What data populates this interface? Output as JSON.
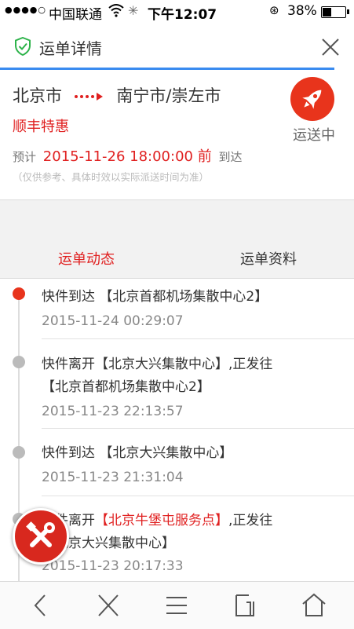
{
  "status_bar": {
    "signal": "●●●●○",
    "carrier": "中国联通",
    "time": "下午12:07",
    "battery": "38%",
    "battery_level": 0.38
  },
  "header": {
    "title": "运单详情"
  },
  "summary": {
    "origin": "北京市",
    "destination": "南宁市/崇左市",
    "service": "顺丰特惠",
    "eta_prefix": "预计",
    "eta_time": "2015-11-26 18:00:00 前",
    "eta_suffix": "到达",
    "note": "（仅供参考、具体时效以实际派送时间为准）",
    "status": "运送中"
  },
  "tabs": [
    {
      "label": "运单动态",
      "active": true
    },
    {
      "label": "运单资料",
      "active": false
    }
  ],
  "events": [
    {
      "line1_pre": "快件到达 ",
      "line1_loc": "【北京首都机场集散中心2】",
      "line1_post": "",
      "line2": "",
      "time": "2015-11-24 00:29:07"
    },
    {
      "line1_pre": "快件离开",
      "line1_loc": "【北京大兴集散中心】",
      "line1_post": ",正发往",
      "line2": "【北京首都机场集散中心2】",
      "time": "2015-11-23 22:13:57"
    },
    {
      "line1_pre": "快件到达 ",
      "line1_loc": "【北京大兴集散中心】",
      "line1_post": "",
      "line2": "",
      "time": "2015-11-23 21:31:04"
    },
    {
      "line1_pre": "快件离开",
      "line1_loc": "【北京牛堡屯服务点】",
      "line1_post": ",正发往",
      "line2": "【北京大兴集散中心】",
      "time": "2015-11-23 20:17:33"
    }
  ],
  "colors": {
    "accent_red": "#e02020",
    "progress_blue": "#3a8bf0",
    "badge_red": "#e8341c"
  },
  "icons": {
    "header_left": "shield-icon",
    "header_right": "close-icon",
    "status": "rocket-icon",
    "fab": "tools-icon",
    "nav": [
      "back-icon",
      "close-icon",
      "menu-icon",
      "tabs-icon",
      "home-icon"
    ]
  }
}
